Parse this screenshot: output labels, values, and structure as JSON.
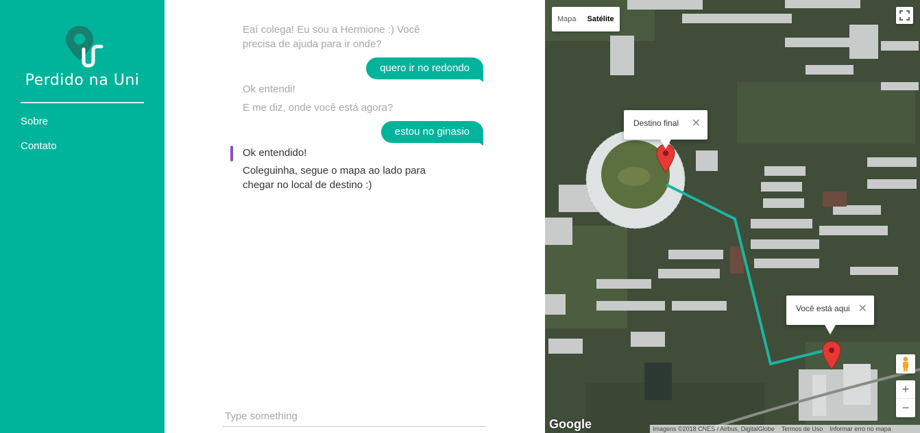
{
  "sidebar": {
    "brand": "Perdido na Uni",
    "nav": [
      {
        "label": "Sobre"
      },
      {
        "label": "Contato"
      }
    ],
    "bg_color": "#00b39b"
  },
  "chat": {
    "messages": [
      {
        "from": "bot",
        "text": "Eaí colega! Eu sou a Hermione :) Você precisa de ajuda para ir onde?"
      },
      {
        "from": "user",
        "text": "quero ir no redondo"
      },
      {
        "from": "bot",
        "text": "Ok entendi!"
      },
      {
        "from": "bot",
        "text": "E me diz, onde você está agora?"
      },
      {
        "from": "user",
        "text": "estou no ginasio"
      },
      {
        "from": "bot",
        "text": "Ok entendido!"
      },
      {
        "from": "bot",
        "text": "Coleguinha, segue o mapa ao lado para chegar no local de destino :)"
      }
    ],
    "input_placeholder": "Type something",
    "accent_color": "#00b39b",
    "active_marker_color": "#8a4fd0"
  },
  "map": {
    "type_options": [
      {
        "label": "Mapa"
      },
      {
        "label": "Satélite",
        "selected": true
      }
    ],
    "info_destination": "Destino final",
    "info_current": "Você está aqui",
    "zoom_in": "+",
    "zoom_out": "−",
    "close_glyph": "✕",
    "google_logo": "Google",
    "attribution": [
      "Imagens ©2018 CNES / Airbus, DigitalGlobe",
      "Termos de Uso",
      "Informar erro no mapa"
    ],
    "route_color": "#1fb3a0",
    "marker_color": "#e53935"
  }
}
